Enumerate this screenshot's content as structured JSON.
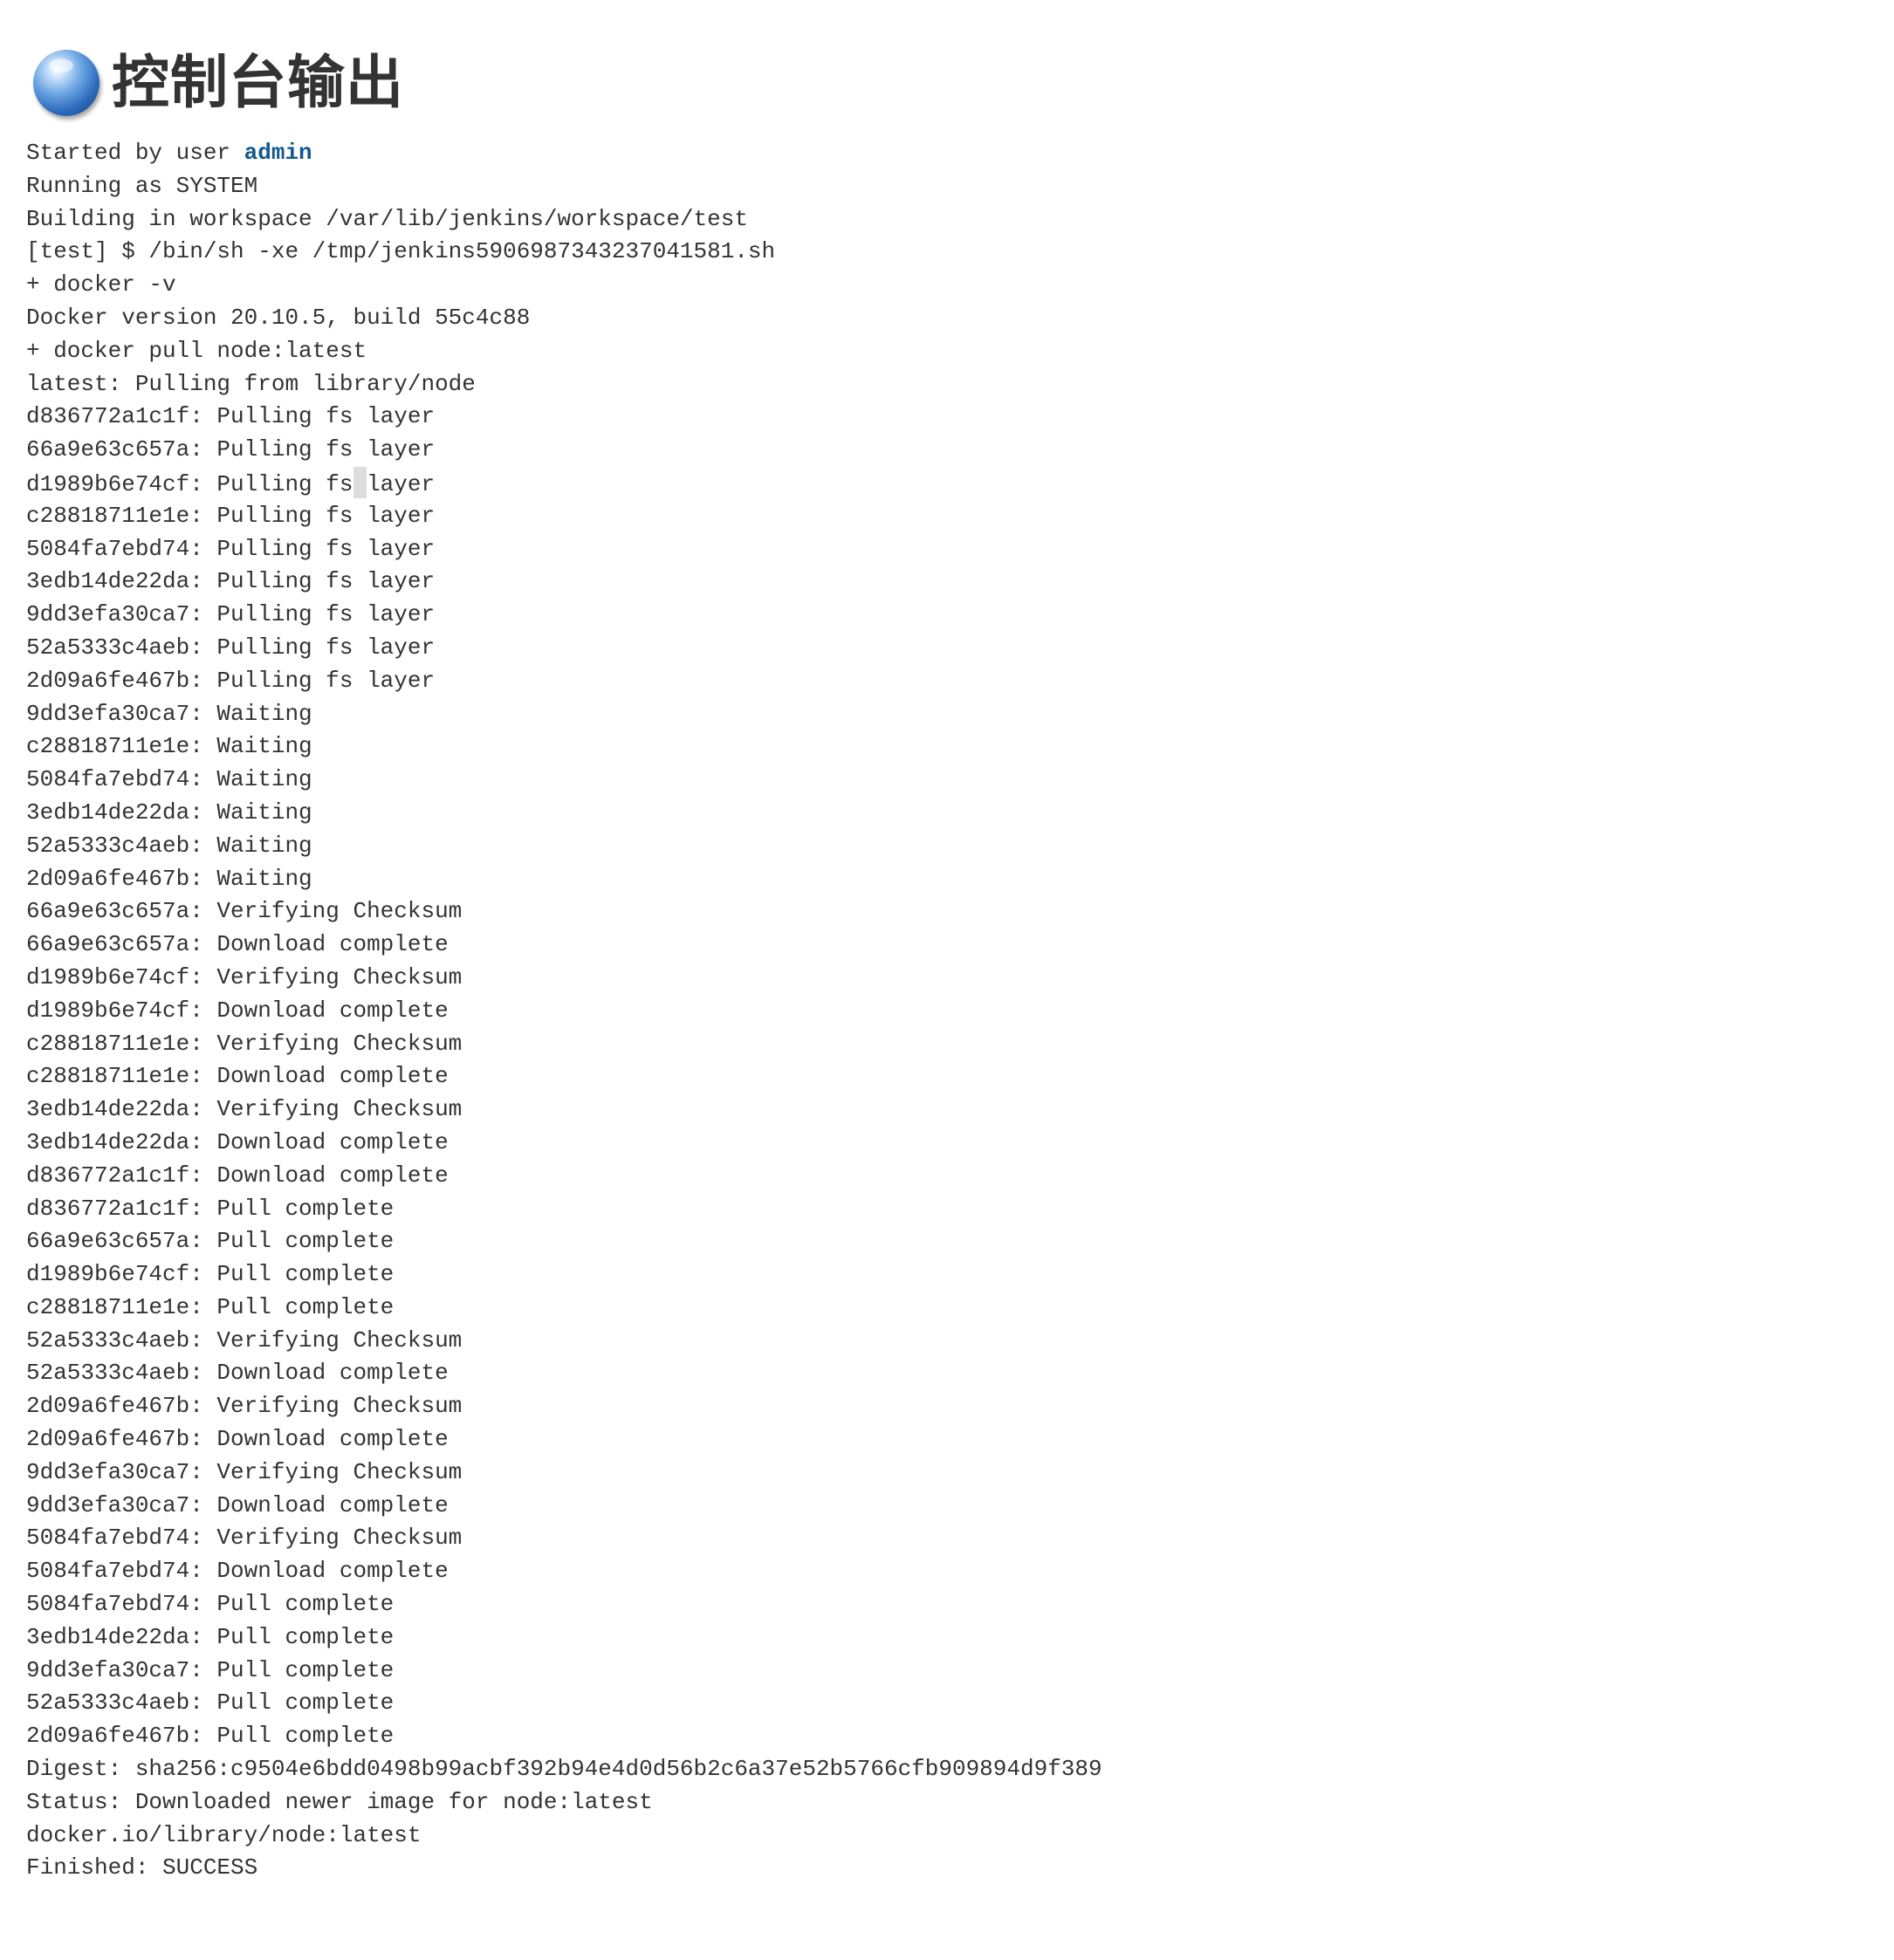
{
  "page": {
    "title": "控制台输出",
    "icon": "blue-ball-icon"
  },
  "console": {
    "started_prefix": "Started by user ",
    "started_user": "admin",
    "lines": [
      "Running as SYSTEM",
      "Building in workspace /var/lib/jenkins/workspace/test",
      "[test] $ /bin/sh -xe /tmp/jenkins5906987343237041581.sh",
      "+ docker -v",
      "Docker version 20.10.5, build 55c4c88",
      "+ docker pull node:latest",
      "latest: Pulling from library/node",
      "d836772a1c1f: Pulling fs layer",
      "66a9e63c657a: Pulling fs layer",
      "d1989b6e74cf: Pulling fs layer",
      "c28818711e1e: Pulling fs layer",
      "5084fa7ebd74: Pulling fs layer",
      "3edb14de22da: Pulling fs layer",
      "9dd3efa30ca7: Pulling fs layer",
      "52a5333c4aeb: Pulling fs layer",
      "2d09a6fe467b: Pulling fs layer",
      "9dd3efa30ca7: Waiting",
      "c28818711e1e: Waiting",
      "5084fa7ebd74: Waiting",
      "3edb14de22da: Waiting",
      "52a5333c4aeb: Waiting",
      "2d09a6fe467b: Waiting",
      "66a9e63c657a: Verifying Checksum",
      "66a9e63c657a: Download complete",
      "d1989b6e74cf: Verifying Checksum",
      "d1989b6e74cf: Download complete",
      "c28818711e1e: Verifying Checksum",
      "c28818711e1e: Download complete",
      "3edb14de22da: Verifying Checksum",
      "3edb14de22da: Download complete",
      "d836772a1c1f: Download complete",
      "d836772a1c1f: Pull complete",
      "66a9e63c657a: Pull complete",
      "d1989b6e74cf: Pull complete",
      "c28818711e1e: Pull complete",
      "52a5333c4aeb: Verifying Checksum",
      "52a5333c4aeb: Download complete",
      "2d09a6fe467b: Verifying Checksum",
      "2d09a6fe467b: Download complete",
      "9dd3efa30ca7: Verifying Checksum",
      "9dd3efa30ca7: Download complete",
      "5084fa7ebd74: Verifying Checksum",
      "5084fa7ebd74: Download complete",
      "5084fa7ebd74: Pull complete",
      "3edb14de22da: Pull complete",
      "9dd3efa30ca7: Pull complete",
      "52a5333c4aeb: Pull complete",
      "2d09a6fe467b: Pull complete",
      "Digest: sha256:c9504e6bdd0498b99acbf392b94e4d0d56b2c6a37e52b5766cfb909894d9f389",
      "Status: Downloaded newer image for node:latest",
      "docker.io/library/node:latest",
      "Finished: SUCCESS"
    ]
  },
  "colors": {
    "text": "#333333",
    "link": "#15588f",
    "background": "#ffffff"
  }
}
